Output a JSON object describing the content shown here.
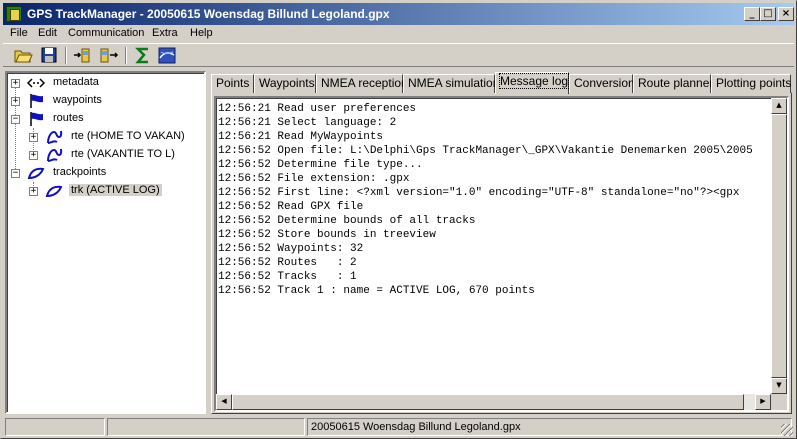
{
  "window": {
    "title": "GPS TrackManager - 20050615 Woensdag Billund Legoland.gpx",
    "controls": {
      "minimize": "_",
      "maximize": "□",
      "close": "×"
    }
  },
  "menu": [
    "File",
    "Edit",
    "Communication",
    "Extra",
    "Help"
  ],
  "toolbar": {
    "buttons": [
      "open-folder-icon",
      "save-icon",
      "import-icon",
      "export-icon",
      "sigma-icon",
      "globe-icon"
    ]
  },
  "tree": {
    "nodes": [
      {
        "label": "metadata",
        "icon": "metadata-arrows-icon",
        "expander": "+"
      },
      {
        "label": "waypoints",
        "icon": "blue-flag-icon",
        "expander": "+"
      },
      {
        "label": "routes",
        "icon": "blue-flag-icon",
        "expander": "−"
      },
      {
        "label": "rte (HOME TO VAKAN)",
        "icon": "route-curve-icon",
        "expander": "+"
      },
      {
        "label": "rte (VAKANTIE TO L)",
        "icon": "route-curve-icon",
        "expander": "+"
      },
      {
        "label": "trackpoints",
        "icon": "track-curve-icon",
        "expander": "−"
      },
      {
        "label": "trk (ACTIVE LOG)",
        "icon": "track-curve-icon",
        "expander": "+"
      }
    ]
  },
  "tabs": [
    {
      "label": "Points"
    },
    {
      "label": "Waypoints"
    },
    {
      "label": "NMEA reception"
    },
    {
      "label": "NMEA simulation"
    },
    {
      "label": "Message log",
      "active": true
    },
    {
      "label": "Conversion"
    },
    {
      "label": "Route planner"
    },
    {
      "label": "Plotting points"
    }
  ],
  "log": [
    "12:56:21 Read user preferences",
    "12:56:21 Select language: 2",
    "12:56:21 Read MyWaypoints",
    "12:56:52 Open file: L:\\Delphi\\Gps TrackManager\\_GPX\\Vakantie Denemarken 2005\\2005",
    "12:56:52 Determine file type...",
    "12:56:52 File extension: .gpx",
    "12:56:52 First line: <?xml version=\"1.0\" encoding=\"UTF-8\" standalone=\"no\"?><gpx",
    "12:56:52 Read GPX file",
    "12:56:52 Determine bounds of all tracks",
    "12:56:52 Store bounds in treeview",
    "12:56:52 Waypoints: 32",
    "12:56:52 Routes   : 2",
    "12:56:52 Tracks   : 1",
    "12:56:52 Track 1 : name = ACTIVE LOG, 670 points"
  ],
  "scrollbars": {
    "up": "▲",
    "down": "▼",
    "left": "◀",
    "right": "▶"
  },
  "status": {
    "panel1": "",
    "panel2": "",
    "file": "20050615 Woensdag Billund Legoland.gpx"
  },
  "colors": {
    "titlebar_start": "#0a246a",
    "titlebar_end": "#a6caf0",
    "face": "#d4d0c8",
    "flag_blue": "#1010c0"
  }
}
